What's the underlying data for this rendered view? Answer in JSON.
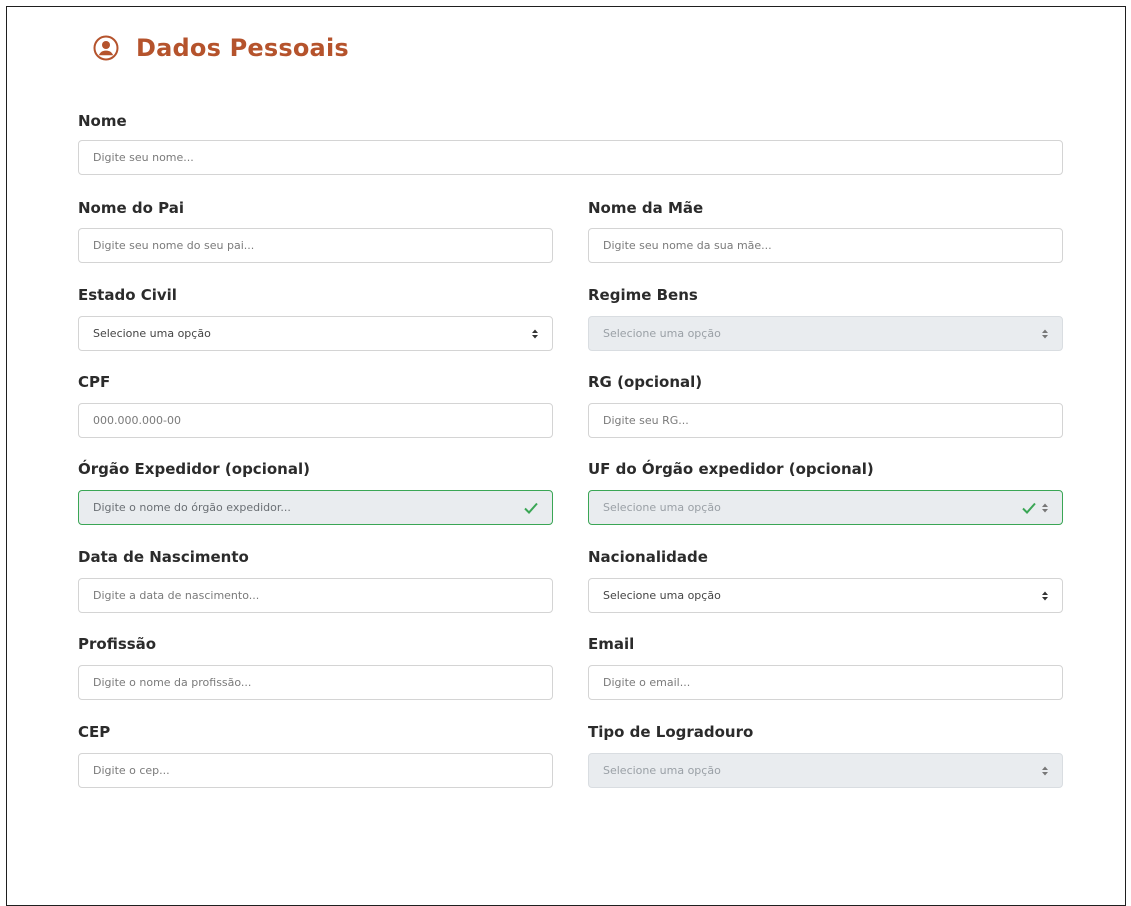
{
  "header": {
    "icon": "user-circle-icon",
    "title": "Dados Pessoais",
    "accent_color": "#b5532c"
  },
  "form": {
    "nome": {
      "label": "Nome",
      "placeholder": "Digite seu nome..."
    },
    "nome_pai": {
      "label": "Nome do Pai",
      "placeholder": "Digite seu nome do seu pai..."
    },
    "nome_mae": {
      "label": "Nome da Mãe",
      "placeholder": "Digite seu nome da sua mãe..."
    },
    "estado_civil": {
      "label": "Estado Civil",
      "value": "Selecione uma opção"
    },
    "regime_bens": {
      "label": "Regime Bens",
      "value": "Selecione uma opção",
      "disabled": true
    },
    "cpf": {
      "label": "CPF",
      "placeholder": "000.000.000-00"
    },
    "rg": {
      "label": "RG (opcional)",
      "placeholder": "Digite seu RG..."
    },
    "orgao_expedidor": {
      "label": "Órgão Expedidor (opcional)",
      "placeholder": "Digite o nome do órgão expedidor...",
      "valid": true
    },
    "uf_orgao": {
      "label": "UF do Órgão expedidor (opcional)",
      "value": "Selecione uma opção",
      "valid": true
    },
    "data_nascimento": {
      "label": "Data de Nascimento",
      "placeholder": "Digite a data de nascimento..."
    },
    "nacionalidade": {
      "label": "Nacionalidade",
      "value": "Selecione uma opção"
    },
    "profissao": {
      "label": "Profissão",
      "placeholder": "Digite o nome da profissão..."
    },
    "email": {
      "label": "Email",
      "placeholder": "Digite o email..."
    },
    "cep": {
      "label": "CEP",
      "placeholder": "Digite o cep..."
    },
    "tipo_logradouro": {
      "label": "Tipo de Logradouro",
      "value": "Selecione uma opção",
      "disabled": true
    }
  },
  "colors": {
    "valid_border": "#3aa655",
    "disabled_bg": "#e9ecef"
  }
}
